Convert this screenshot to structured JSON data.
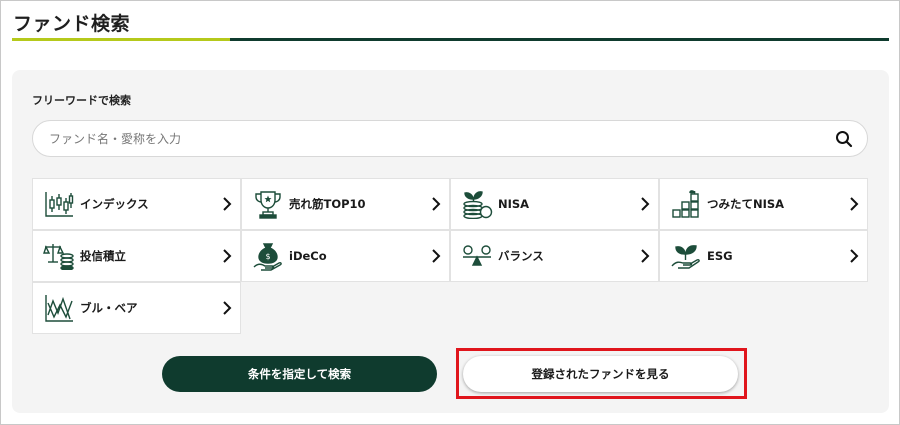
{
  "header": {
    "title": "ファンド検索"
  },
  "search": {
    "label": "フリーワードで検索",
    "placeholder": "ファンド名・愛称を入力",
    "value": "",
    "icon": "search-icon"
  },
  "categories": [
    {
      "label": "インデックス",
      "icon": "candlestick-chart-icon"
    },
    {
      "label": "売れ筋TOP10",
      "icon": "trophy-icon"
    },
    {
      "label": "NISA",
      "icon": "coins-sprout-icon"
    },
    {
      "label": "つみたてNISA",
      "icon": "blocks-sprout-icon"
    },
    {
      "label": "投信積立",
      "icon": "scale-coins-icon"
    },
    {
      "label": "iDeCo",
      "icon": "money-bag-hand-icon"
    },
    {
      "label": "バランス",
      "icon": "balance-icon"
    },
    {
      "label": "ESG",
      "icon": "hand-sprout-icon"
    },
    {
      "label": "ブル・ベア",
      "icon": "bull-bear-chart-icon"
    }
  ],
  "buttons": {
    "search_by_conditions": "条件を指定して検索",
    "view_registered": "登録されたファンドを見る"
  },
  "colors": {
    "brand_dark": "#0f3b2e",
    "accent": "#b5c91b",
    "highlight": "#e0151c",
    "icon": "#1d4d3a"
  }
}
